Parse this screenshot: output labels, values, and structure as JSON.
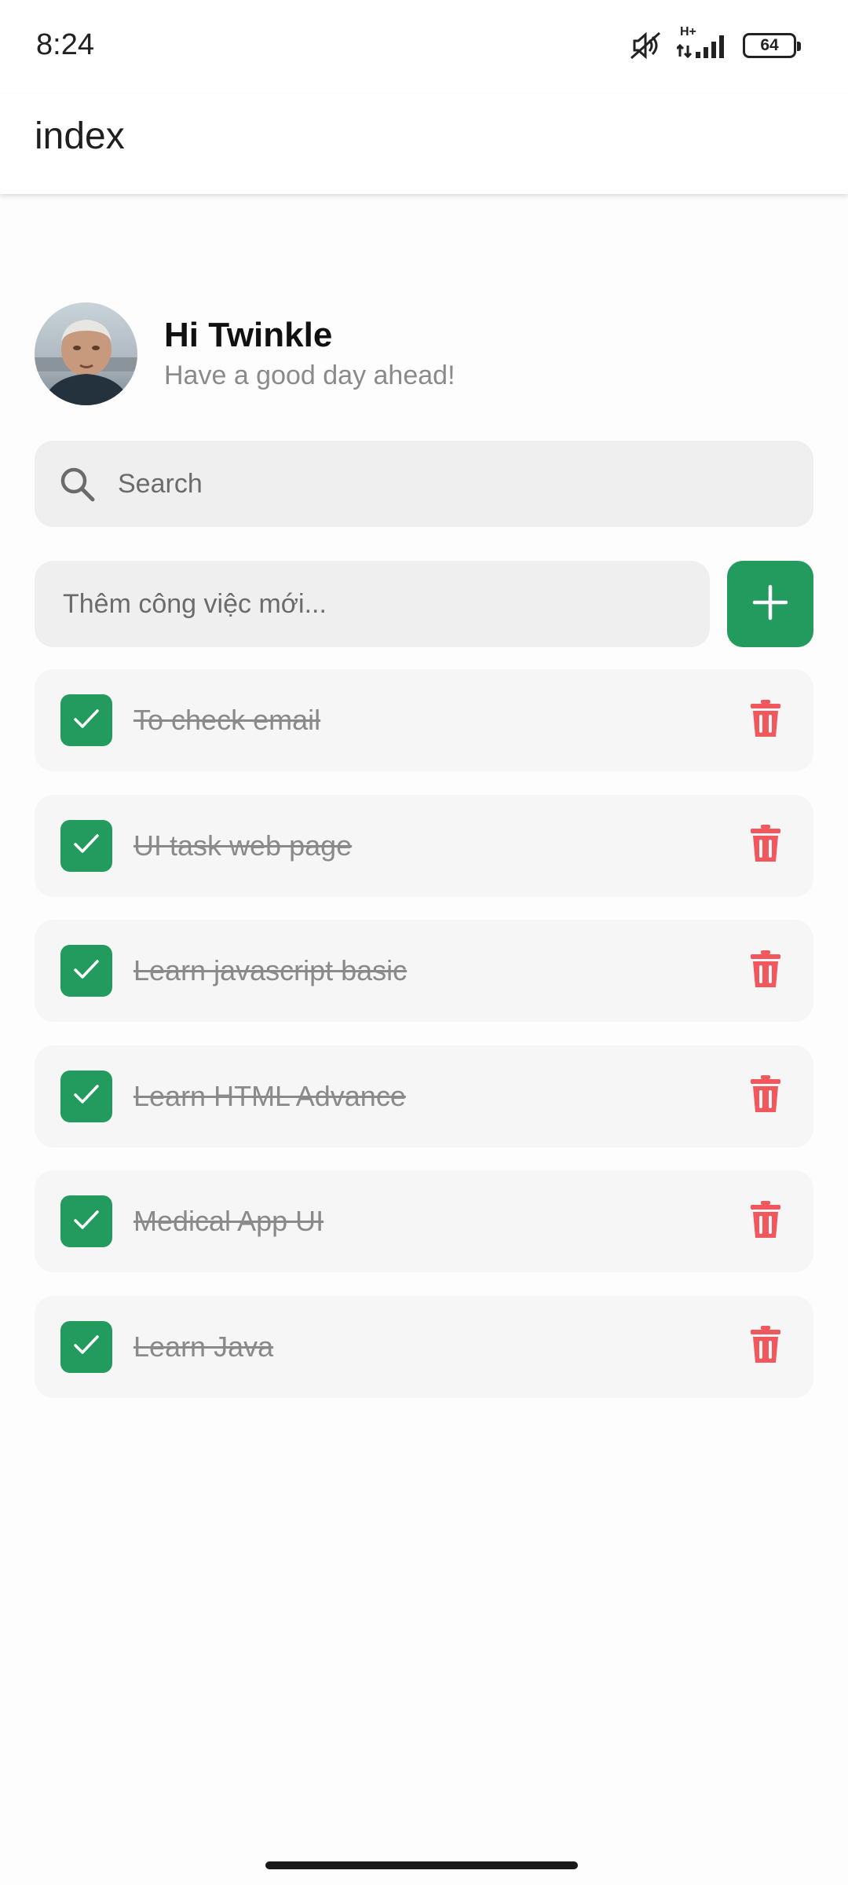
{
  "status_bar": {
    "time": "8:24",
    "network_type": "H+",
    "battery": "64",
    "icons": [
      "mute-icon",
      "signal-icon",
      "battery-icon"
    ]
  },
  "app_bar": {
    "title": "index"
  },
  "profile": {
    "greeting": "Hi Twinkle",
    "subtitle": "Have a good day ahead!"
  },
  "search": {
    "placeholder": "Search"
  },
  "add_task": {
    "placeholder": "Thêm công việc mới..."
  },
  "tasks": [
    {
      "text": "To check email",
      "done": true
    },
    {
      "text": "UI task web page",
      "done": true
    },
    {
      "text": "Learn javascript basic",
      "done": true
    },
    {
      "text": "Learn HTML Advance",
      "done": true
    },
    {
      "text": "Medical App UI",
      "done": true
    },
    {
      "text": "Learn Java",
      "done": true
    }
  ],
  "colors": {
    "accent": "#239b5e",
    "delete": "#f0585e",
    "input_bg": "#efefef",
    "card_bg": "#f6f6f6"
  }
}
